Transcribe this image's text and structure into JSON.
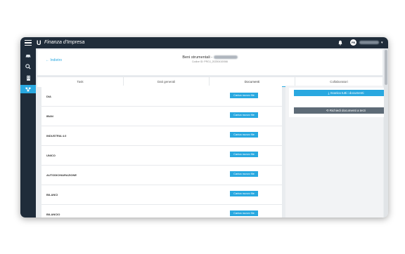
{
  "app": {
    "brand": "Finanza d'Impresa",
    "avatar_initials": "FB"
  },
  "header": {
    "back_label": "← Indietro",
    "title": "Beni strumentali - ",
    "subtitle": "Codice ID: PROJ_20230410/066"
  },
  "tabs": [
    {
      "label": "Task"
    },
    {
      "label": "Dati generali"
    },
    {
      "label": "Documenti",
      "active": true
    },
    {
      "label": "Collaboratori"
    }
  ],
  "documents": [
    {
      "label": "DIA",
      "button": "Carica nuovo file"
    },
    {
      "label": "IBAN",
      "button": "Carica nuovo file"
    },
    {
      "label": "INDUSTRIA 4.0",
      "button": "Carica nuovo file"
    },
    {
      "label": "UNICO",
      "button": "Carica nuovo file"
    },
    {
      "label": "AUTODICHIARAZIONE",
      "button": "Carica nuovo file"
    },
    {
      "label": "BILANCI",
      "button": "Carica nuovo file"
    },
    {
      "label": "BILANCIO",
      "button": "Carica nuovo file"
    }
  ],
  "actions": {
    "download_all": "⤓  Scarica tutti i documenti",
    "request_third": "⟲  Richiedi documenti a terzi"
  },
  "colors": {
    "accent": "#29a8e0",
    "topbar": "#1f2c3a",
    "secondary": "#5e6b77"
  },
  "icons": [
    "menu-icon",
    "logo-icon",
    "bell-icon",
    "chevron-down-icon",
    "car-icon",
    "search-icon",
    "building-icon",
    "sitemap-icon"
  ]
}
